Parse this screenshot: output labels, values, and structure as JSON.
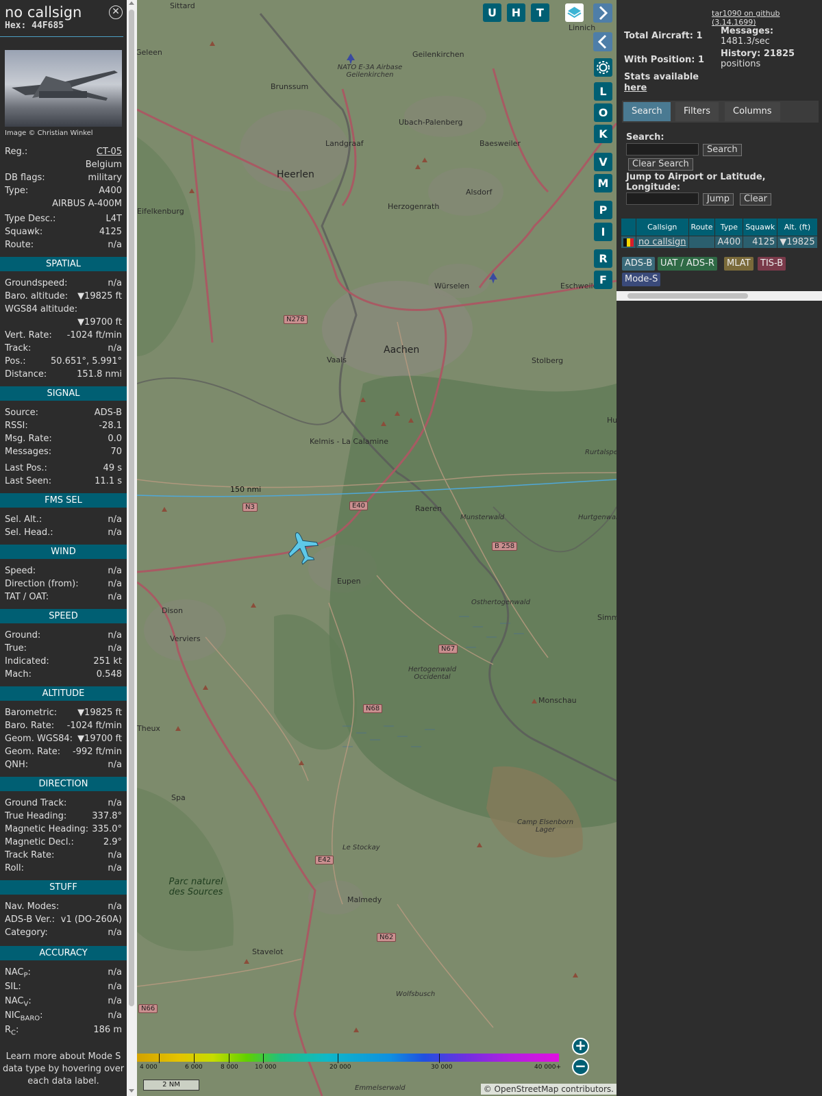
{
  "info": {
    "callsign": "no callsign",
    "hex": "Hex: 44F685",
    "photo_credit": "Image © Christian Winkel",
    "basic": [
      {
        "k": "Reg.:",
        "v": "CT-05",
        "link": true
      },
      {
        "k": "",
        "v": "Belgium"
      },
      {
        "k": "DB flags:",
        "v": "military"
      },
      {
        "k": "Type:",
        "v": "A400"
      },
      {
        "k": "",
        "v": "AIRBUS A-400M"
      },
      {
        "k": "Type Desc.:",
        "v": "L4T"
      },
      {
        "k": "Squawk:",
        "v": "4125"
      },
      {
        "k": "Route:",
        "v": "n/a"
      }
    ],
    "sections": [
      {
        "title": "SPATIAL",
        "rows": [
          {
            "k": "Groundspeed:",
            "v": "n/a"
          },
          {
            "k": "Baro. altitude:",
            "v": "▼19825 ft"
          },
          {
            "k": "WGS84 altitude:",
            "v": ""
          },
          {
            "k": "",
            "v": "▼19700 ft"
          },
          {
            "k": "Vert. Rate:",
            "v": "-1024 ft/min"
          },
          {
            "k": "Track:",
            "v": "n/a"
          },
          {
            "k": "Pos.:",
            "v": "50.651°, 5.991°"
          },
          {
            "k": "Distance:",
            "v": "151.8 nmi"
          }
        ]
      },
      {
        "title": "SIGNAL",
        "rows": [
          {
            "k": "Source:",
            "v": "ADS-B"
          },
          {
            "k": "RSSI:",
            "v": "-28.1"
          },
          {
            "k": "Msg. Rate:",
            "v": "0.0"
          },
          {
            "k": "Messages:",
            "v": "70"
          },
          {
            "k": "Last Pos.:",
            "v": "49 s"
          },
          {
            "k": "Last Seen:",
            "v": "11.1 s"
          }
        ]
      },
      {
        "title": "FMS SEL",
        "rows": [
          {
            "k": "Sel. Alt.:",
            "v": "n/a"
          },
          {
            "k": "Sel. Head.:",
            "v": "n/a"
          }
        ]
      },
      {
        "title": "WIND",
        "rows": [
          {
            "k": "Speed:",
            "v": "n/a"
          },
          {
            "k": "Direction (from):",
            "v": "n/a"
          },
          {
            "k": "TAT / OAT:",
            "v": "n/a"
          }
        ]
      },
      {
        "title": "SPEED",
        "rows": [
          {
            "k": "Ground:",
            "v": "n/a"
          },
          {
            "k": "True:",
            "v": "n/a"
          },
          {
            "k": "Indicated:",
            "v": "251 kt"
          },
          {
            "k": "Mach:",
            "v": "0.548"
          }
        ]
      },
      {
        "title": "ALTITUDE",
        "rows": [
          {
            "k": "Barometric:",
            "v": "▼19825 ft"
          },
          {
            "k": "Baro. Rate:",
            "v": "-1024 ft/min"
          },
          {
            "k": "Geom. WGS84:",
            "v": "▼19700 ft"
          },
          {
            "k": "Geom. Rate:",
            "v": "-992 ft/min"
          },
          {
            "k": "QNH:",
            "v": "n/a"
          }
        ]
      },
      {
        "title": "DIRECTION",
        "rows": [
          {
            "k": "Ground Track:",
            "v": "n/a"
          },
          {
            "k": "True Heading:",
            "v": "337.8°"
          },
          {
            "k": "Magnetic Heading:",
            "v": "335.0°"
          },
          {
            "k": "Magnetic Decl.:",
            "v": "2.9°"
          },
          {
            "k": "Track Rate:",
            "v": "n/a"
          },
          {
            "k": "Roll:",
            "v": "n/a"
          }
        ]
      },
      {
        "title": "STUFF",
        "rows": [
          {
            "k": "Nav. Modes:",
            "v": "n/a"
          },
          {
            "k": "ADS-B Ver.:",
            "v": "v1 (DO-260A)"
          },
          {
            "k": "Category:",
            "v": "n/a"
          }
        ]
      }
    ],
    "accuracy_title": "ACCURACY",
    "accuracy": [
      {
        "k": "NAC",
        "sub": "P",
        "v": "n/a"
      },
      {
        "k": "SIL:",
        "sub": "",
        "v": "n/a"
      },
      {
        "k": "NAC",
        "sub": "V",
        "v": "n/a"
      },
      {
        "k": "NIC",
        "sub": "BARO",
        "v": "n/a"
      },
      {
        "k": "R",
        "sub": "C",
        "v": "186 m"
      }
    ],
    "footer": "Learn more about Mode S data type by hovering over each data label."
  },
  "map": {
    "top_buttons": [
      "U",
      "H",
      "T"
    ],
    "side_buttons": [
      "L",
      "O",
      "K",
      "V",
      "M",
      "P",
      "I",
      "R",
      "F"
    ],
    "range_ring_label": "150 nmi",
    "labels": [
      "Sittard",
      "Geleen",
      "Brunssum",
      "Geilenkirchen",
      "NATO E-3A Airbase Geilenkirchen",
      "Linnich",
      "Ubach-Palenberg",
      "Landgraaf",
      "Heerlen",
      "Baesweiler",
      "Herzogenrath",
      "Alsdorf",
      "Würselen",
      "Eschweiler",
      "Aachen",
      "Vaals",
      "Stolberg",
      "Kelmis - La Calamine",
      "Raeren",
      "Hurtgenwald",
      "Munsterwald",
      "Eupen",
      "Dison",
      "Verviers",
      "Osthertogenwald",
      "Hertogenwald Occidental",
      "Monschau",
      "Spa",
      "Le Stockay",
      "Camp Elsenborn Lager",
      "Parc naturel des Sources",
      "Malmedy",
      "Stavelot",
      "Wolfsbusch",
      "Emmelserwald",
      "Simm",
      "Eifelkenburg",
      "Theux",
      "Hu",
      "Rurtalsperre Wald"
    ],
    "roads": [
      "N278",
      "N3",
      "E40",
      "B 258",
      "N67",
      "N68",
      "E42",
      "N62",
      "N66"
    ],
    "colorbar_labels": [
      "4 000",
      "6 000",
      "8 000",
      "10 000",
      "20 000",
      "30 000",
      "40 000+"
    ],
    "scale_label": "2 NM",
    "attribution": "© OpenStreetMap contributors."
  },
  "right": {
    "github": "tar1090 on github (3.14.1699)",
    "total_aircraft": "Total Aircraft: 1",
    "with_position": "With Position: 1",
    "messages_label": "Messages:",
    "messages_value": "1481.3/sec",
    "history_label": "History: 21825",
    "history_value": "positions",
    "stats_label": "Stats available",
    "stats_link": "here",
    "tabs": [
      "Search",
      "Filters",
      "Columns"
    ],
    "search_label": "Search:",
    "search_button": "Search",
    "clear_search_button": "Clear Search",
    "jump_label": "Jump to Airport or Latitude, Longitude:",
    "jump_button": "Jump",
    "clear_button": "Clear",
    "table_headers": [
      "",
      "Callsign",
      "Route",
      "Type",
      "Squawk",
      "Alt. (ft)"
    ],
    "table_row": {
      "callsign": "no callsign",
      "route": "",
      "type": "A400",
      "squawk": "4125",
      "alt": "▼19825"
    },
    "sources": [
      "ADS-B",
      "UAT / ADS-R",
      "MLAT",
      "TIS-B",
      "Mode-S"
    ]
  }
}
